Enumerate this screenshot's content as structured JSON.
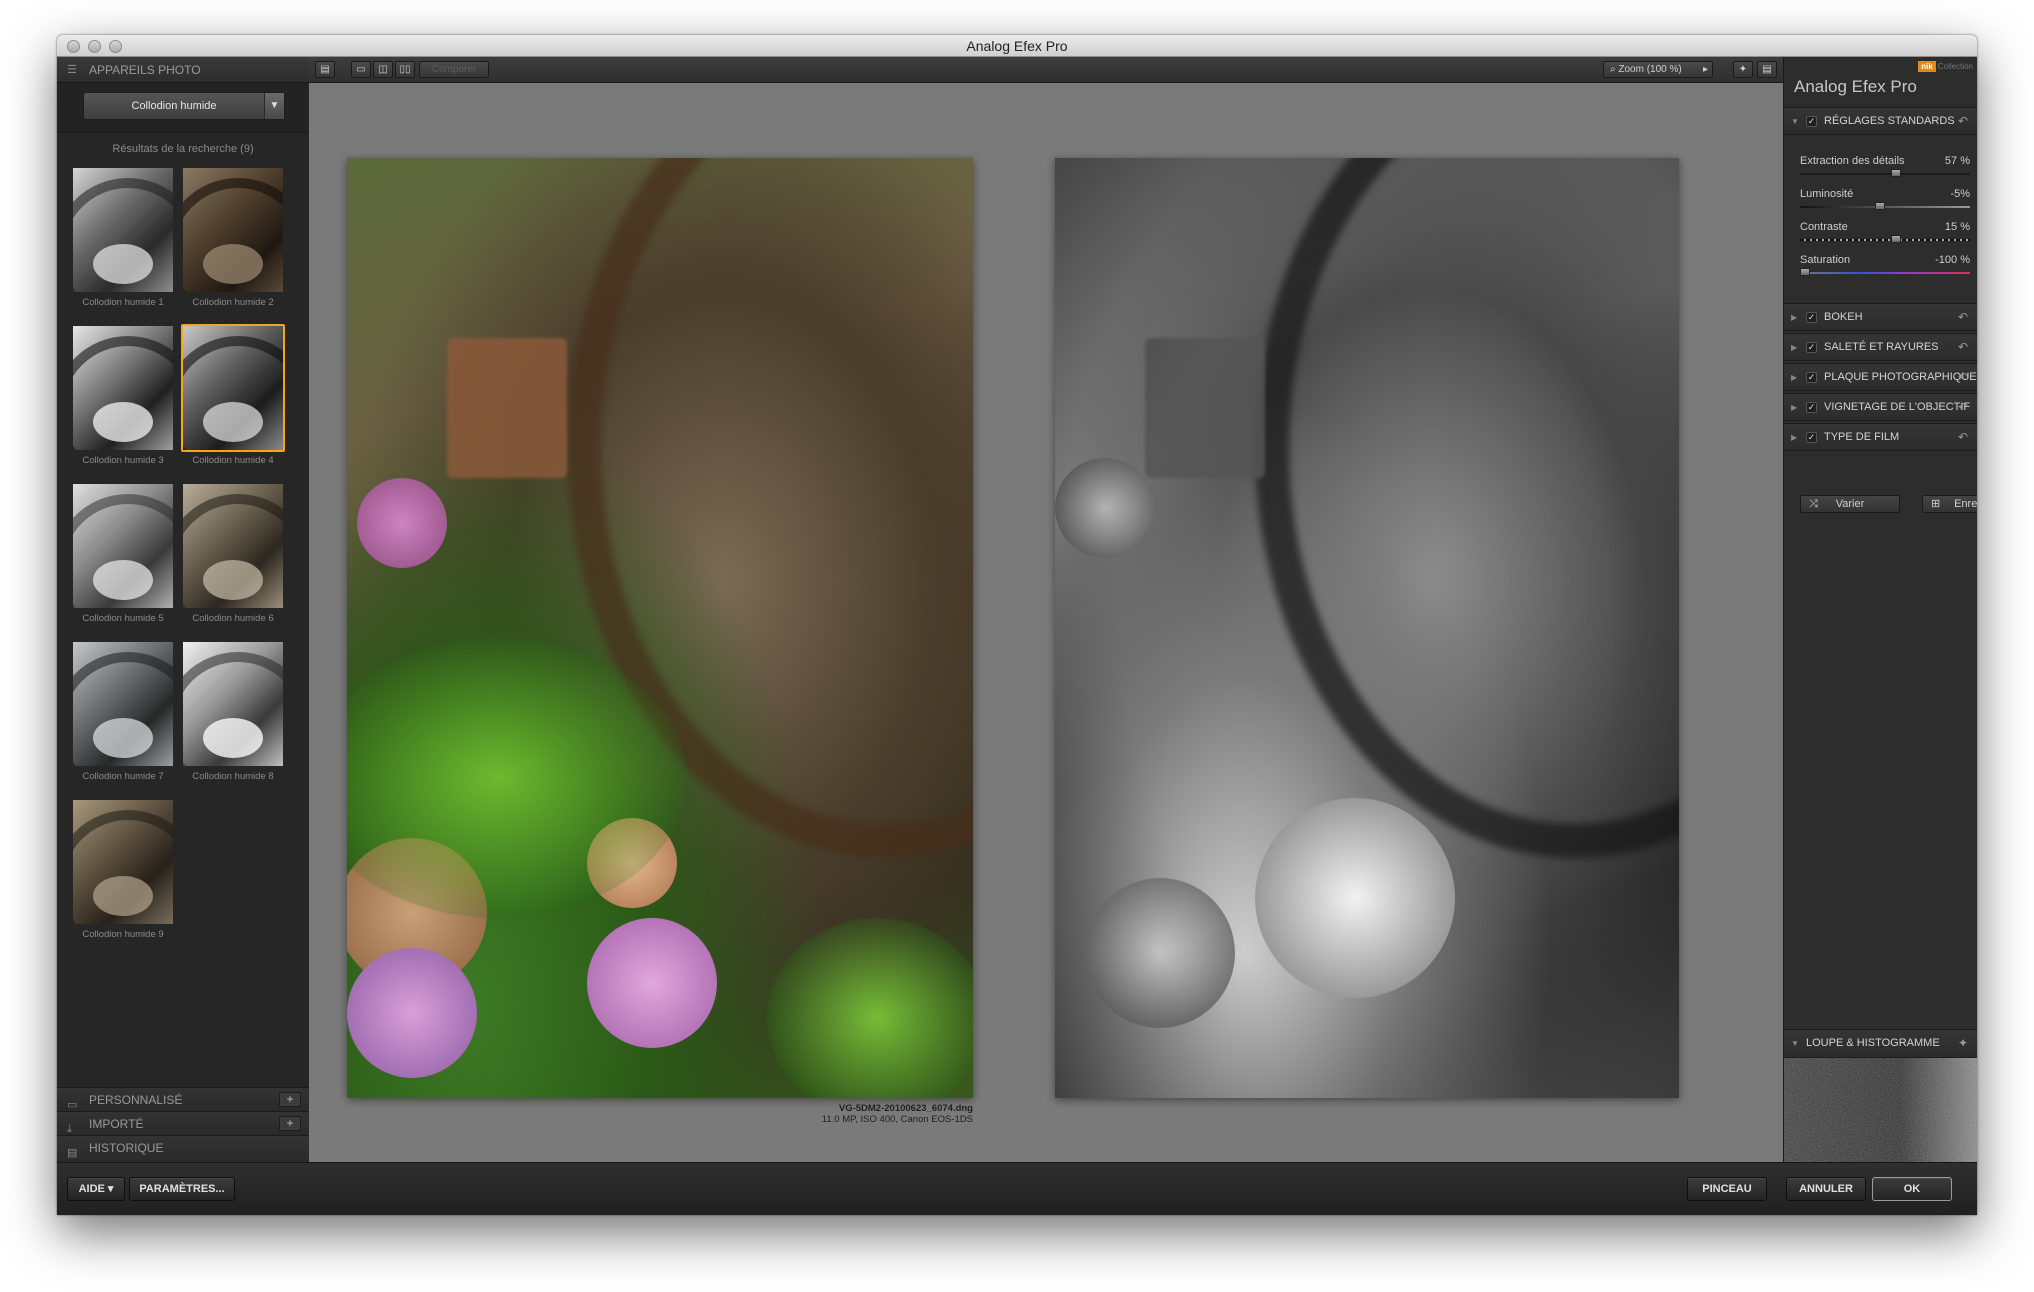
{
  "window": {
    "title": "Analog Efex Pro"
  },
  "left_panel": {
    "header": "APPAREILS PHOTO",
    "preset": "Collodion humide",
    "results_label": "Résultats de la recherche (9)",
    "thumbnails": [
      {
        "label": "Collodion humide 1"
      },
      {
        "label": "Collodion humide 2"
      },
      {
        "label": "Collodion humide 3"
      },
      {
        "label": "Collodion humide 4"
      },
      {
        "label": "Collodion humide 5"
      },
      {
        "label": "Collodion humide 6"
      },
      {
        "label": "Collodion humide 7"
      },
      {
        "label": "Collodion humide 8"
      },
      {
        "label": "Collodion humide 9"
      }
    ],
    "selected_thumbnail": "Collodion humide 4",
    "sections": [
      "PERSONNALISÉ",
      "IMPORTÉ",
      "HISTORIQUE"
    ]
  },
  "toolbar": {
    "compare_label": "Comparer",
    "zoom_label": "Zoom (100 %)"
  },
  "preview": {
    "filename": "VG-5DM2-20100623_6074.dng",
    "fileinfo": "11.0 MP, ISO 400, Canon EOS-1DS"
  },
  "right_panel": {
    "title": "Analog Efex Pro",
    "brand": "Collection",
    "brand_badge": "nik",
    "main_section": "RÉGLAGES STANDARDS",
    "sliders": [
      {
        "label": "Extraction des détails",
        "value": "57 %",
        "position": 0.57
      },
      {
        "label": "Luminosité",
        "value": "-5%",
        "position": 0.47
      },
      {
        "label": "Contraste",
        "value": "15 %",
        "position": 0.57
      },
      {
        "label": "Saturation",
        "value": "-100 %",
        "position": 0.0
      }
    ],
    "sections": [
      "BOKEH",
      "SALETÉ ET RAYURES",
      "PLAQUE PHOTOGRAPHIQUE",
      "VIGNETAGE DE L'OBJECTIF",
      "TYPE DE FILM"
    ],
    "vary_label": "Varier",
    "save_label": "Enregistrer",
    "loupe_label": "LOUPE & HISTOGRAMME"
  },
  "bottom_bar": {
    "help_label": "AIDE",
    "settings_label": "PARAMÈTRES...",
    "brush_label": "PINCEAU",
    "cancel_label": "ANNULER",
    "ok_label": "OK"
  },
  "colors": {
    "selection": "#f3a51b",
    "panel": "#2b2b2b",
    "canvas": "#7a7a7a"
  }
}
